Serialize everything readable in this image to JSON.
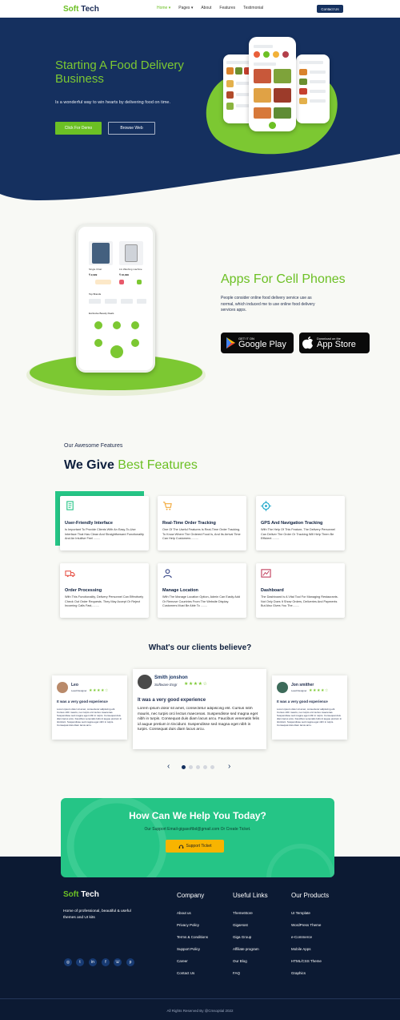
{
  "brand": {
    "soft": "Soft",
    "tech": "Tech"
  },
  "nav": {
    "items": [
      "Home ▾",
      "Pages ▾",
      "About",
      "Features",
      "Testimonial"
    ],
    "contact": "Contact Us"
  },
  "hero": {
    "title": "Starting A Food Delivery Business",
    "subtitle": "Is a wonderful way to win hearts by delivering food on time.",
    "demo_button": "Click For Demo",
    "browse_button": "Browse Web"
  },
  "apps": {
    "title": "Apps For Cell Phones",
    "text": "People consider online food delivery service use as normal, which induced me to use online food delivery services apps.",
    "google_small": "GET IT ON",
    "google_big": "Google Play",
    "apple_small": "Download on the",
    "apple_big": "App Store",
    "phone": {
      "product1": "Single Chair",
      "price1": "₹ 2,999",
      "product2": "LG Washing machine",
      "price2": "₹ 16,999",
      "top_brands": "Top Brands",
      "exclusive": "Exclusive Beauty Deals"
    }
  },
  "features": {
    "pre": "Our Awesome Features",
    "title_a": "We Give",
    "title_b": "Best Features",
    "cards": [
      {
        "title": "User-Friendly Interface",
        "text": "Is Important To Provide Clients With An Easy-To-Use Interface That Has Clean And Straightforward Functionality And An Intuitive Feel ........"
      },
      {
        "title": "Real-Time Order Tracking",
        "text": "One Of The Useful Features Is Real-Time Order Tracking. To Know Where The Ordered Food Is, And Its Arrival Time Can Help Customers ........"
      },
      {
        "title": "GPS And Navigation Tracking",
        "text": "With The Help Of This Feature, The Delivery Personnel Can Deliver The Order Or Tracking Will Help Them Be Efficient ........"
      },
      {
        "title": "Order Processing",
        "text": "With This Functionality, Delivery Personnel Can Effectively Check Out Order Requests. They May Accept Or Reject Incoming Calls Fast,........"
      },
      {
        "title": "Manage Location",
        "text": "With The Manage Location Option, Admin Can Easily Add Or Remove Countries From The Website Display. Customers Must Be Able To ........"
      },
      {
        "title": "Dashboard",
        "text": "The Dashboard Is A Vital Tool For Managing Restaurants. Not Only Does It Show Orders, Deliveries And Payments But Also Gives You The........"
      }
    ]
  },
  "testimonials": {
    "title": "What's our clients believe?",
    "items": [
      {
        "name": "Leo",
        "role": "Lead Designer",
        "stars": "★★★★☆",
        "heading": "It was a very good experience",
        "text": "Lorem ipsum dolor sit amet, consectetur adipiscing elit. Cursus nibh mauris, nec turpis orci lectus maecenas. Suspendisse sed magna eget nibh in turpis. Consequat duis diam lacus arcu. Faucibus venenatis felis id augue pretium in tincidunt. Suspendisse sed magna eget nibh in turpis. Consequat duis diam lacus arcu."
      },
      {
        "name": "Smith jonshon",
        "role": "Software Engr",
        "stars": "★★★★☆",
        "heading": "It was a very good experience",
        "text": "Lorem ipsum dolor sit amet, consectetur adipiscing elit. Cursus nibh mauris, nec turpis orci lectus maecenas. Suspendisse sed magna eget nibh in turpis. Consequat duis diam lacus arcu. Faucibus venenatis felis id augue pretium in tincidunt. Suspendisse sed magna eget nibh in turpis. Consequat duis diam lacus arcu."
      },
      {
        "name": "Jon smither",
        "role": "Lead Designer",
        "stars": "★★★★☆",
        "heading": "It was a very good experience",
        "text": "Lorem ipsum dolor sit amet, consectetur adipiscing elit. Cursus nibh mauris, nec turpis orci lectus maecenas. Suspendisse sed magna eget nibh in turpis. Consequat duis diam lacus arcu. Faucibus venenatis felis id augue pretium in tincidunt. Suspendisse sed magna eget nibh in turpis. Consequat duis diam lacus arcu."
      }
    ],
    "prev": "‹",
    "next": "›"
  },
  "help": {
    "title": "How Can We Help You Today?",
    "text": "Our Support Email-gigasoftbd@gmail.com Or Create Ticket.",
    "button": "Support Ticket"
  },
  "footer": {
    "about": "Home of professional, beautiful & useful themes and UI kits",
    "company_title": "Company",
    "company": [
      "About us",
      "Privacy Policy",
      "Terms & Conditions",
      "Support Policy",
      "Career",
      "Contact Us"
    ],
    "links_title": "Useful Links",
    "links": [
      "ThemeStore",
      "GigaHost",
      "Giga Group",
      "Affiliate program",
      "Our Blog",
      "FAQ"
    ],
    "products_title": "Our Products",
    "products": [
      "UI Template",
      "WordPress Theme",
      "e-Commerce",
      "Mobile Apps",
      "HTML/CSS Theme",
      "Graphics"
    ],
    "social": [
      "◎",
      "t",
      "in",
      "f",
      "☏",
      "p"
    ],
    "copyright": "All Rights Reserved By @Cmsoptial 2022"
  },
  "colors": {
    "navy": "#14305f",
    "green": "#6cc024",
    "teal": "#25c586",
    "footer": "#0c1a33",
    "yellow": "#f8b400"
  }
}
